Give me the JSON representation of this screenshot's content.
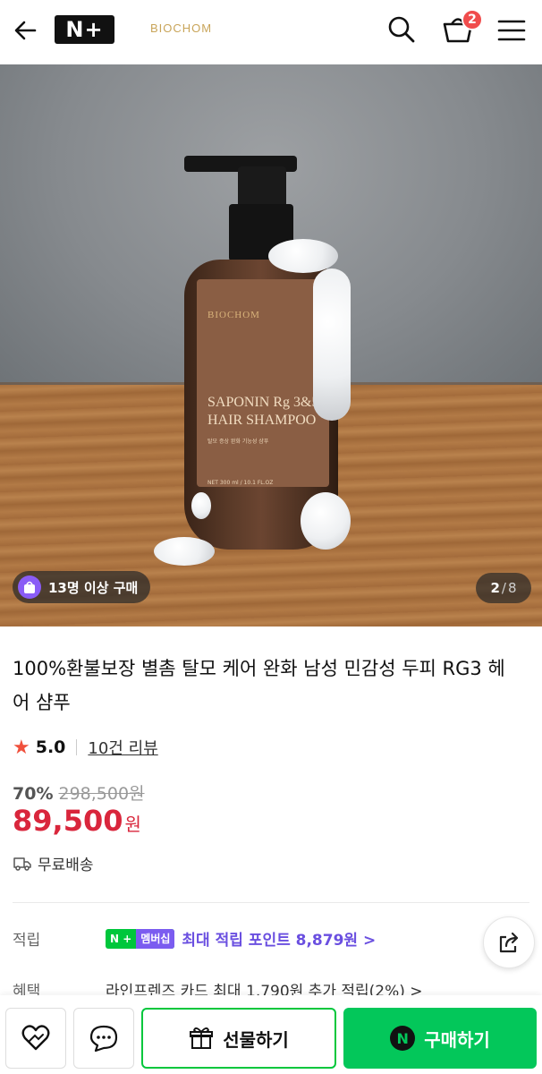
{
  "header": {
    "logo_text": "N+",
    "brand_logo": "BIOCHOM",
    "cart_count": "2",
    "icons": [
      "back-arrow-icon",
      "search-icon",
      "cart-icon",
      "menu-icon"
    ]
  },
  "hero": {
    "bottle_brand": "BIOCHOM",
    "bottle_name_line1": "SAPONIN Rg 3&5",
    "bottle_name_line2": "HAIR SHAMPOO",
    "bottle_sub": "탈모 증상 완화 기능성 샴푸",
    "bottle_volume": "NET 300 ml / 10.1 FL.OZ",
    "purchase_badge": "13명 이상 구매",
    "page_current": "2",
    "page_separator": "/",
    "page_total": "8"
  },
  "product": {
    "title": "100%환불보장 별촘 탈모 케어 완화 남성 민감성 두피 RG3 헤어 샴푸",
    "rating": "5.0",
    "review_link": "10건 리뷰",
    "discount": "70%",
    "original_price": "298,500원",
    "sale_price": "89,500",
    "currency": "원",
    "delivery": "무료배송"
  },
  "info": {
    "points_label": "적립",
    "membership_badge_left": "N +",
    "membership_badge_right": "멤버십",
    "points_text": "최대 적립 포인트 8,879원 >",
    "benefit_label": "혜택",
    "benefit_text": "라인프렌즈 카드 최대 1,790원 추가 적립(2%) >"
  },
  "bottom_bar": {
    "gift_label": "선물하기",
    "buy_label": "구매하기",
    "buy_icon_text": "N"
  },
  "colors": {
    "accent_green": "#03c75a",
    "sale_red": "#d9263c",
    "points_purple": "#6a4fe0",
    "badge_red": "#f04c4c"
  }
}
